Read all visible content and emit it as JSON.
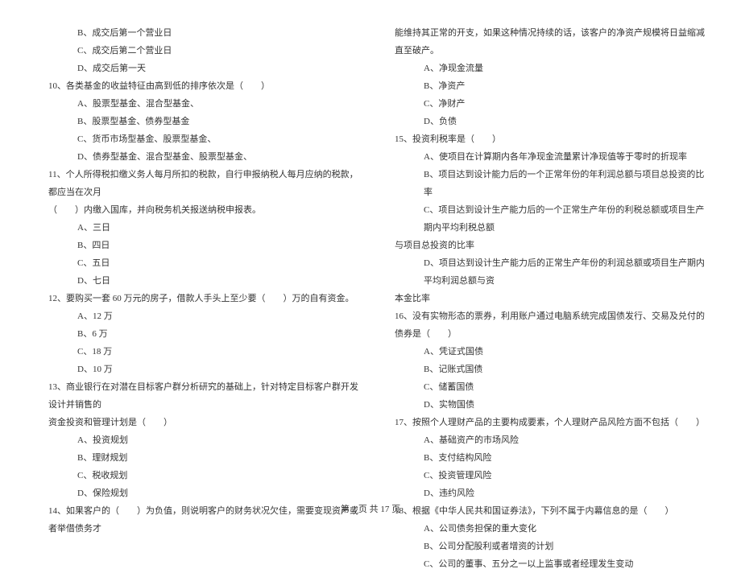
{
  "left": {
    "opt_b": "B、成交后第一个营业日",
    "opt_c": "C、成交后第二个营业日",
    "opt_d": "D、成交后第一天",
    "q10": "10、各类基金的收益特征由高到低的排序依次是（　　）",
    "q10_a": "A、股票型基金、混合型基金、",
    "q10_b": "B、股票型基金、债券型基金",
    "q10_c": "C、货币市场型基金、股票型基金、",
    "q10_d": "D、债券型基金、混合型基金、股票型基金、",
    "q11": "11、个人所得税扣缴义务人每月所扣的税款，自行申报纳税人每月应纳的税款，都应当在次月",
    "q11_cont": "（　　）内缴入国库，并向税务机关报送纳税申报表。",
    "q11_a": "A、三日",
    "q11_b": "B、四日",
    "q11_c": "C、五日",
    "q11_d": "D、七日",
    "q12": "12、要购买一套 60 万元的房子，借款人手头上至少要（　　）万的自有资金。",
    "q12_a": "A、12 万",
    "q12_b": "B、6 万",
    "q12_c": "C、18 万",
    "q12_d": "D、10 万",
    "q13": "13、商业银行在对潜在目标客户群分析研究的基础上，针对特定目标客户群开发设计并销售的",
    "q13_cont": "资金投资和管理计划是（　　）",
    "q13_a": "A、投资规划",
    "q13_b": "B、理财规划",
    "q13_c": "C、税收规划",
    "q13_d": "D、保险规划",
    "q14": "14、如果客户的（　　）为负值，则说明客户的财务状况欠佳，需要变现资产或者举借债务才"
  },
  "right": {
    "q14_cont": "能维持其正常的开支，如果这种情况持续的话，该客户的净资产规模将日益缩减直至破产。",
    "q14_a": "A、净现金流量",
    "q14_b": "B、净资产",
    "q14_c": "C、净财产",
    "q14_d": "D、负债",
    "q15": "15、投资利税率是（　　）",
    "q15_a": "A、使项目在计算期内各年净现金流量累计净现值等于零时的折现率",
    "q15_b": "B、项目达到设计能力后的一个正常年份的年利润总额与项目总投资的比率",
    "q15_c": "C、项目达到设计生产能力后的一个正常生产年份的利税总额或项目生产期内平均利税总额",
    "q15_c_cont": "与项目总投资的比率",
    "q15_d": "D、项目达到设计生产能力后的正常生产年份的利润总额或项目生产期内平均利润总额与资",
    "q15_d_cont": "本金比率",
    "q16": "16、没有实物形态的票券，利用账户通过电脑系统完成国债发行、交易及兑付的债券是（　　）",
    "q16_a": "A、凭证式国债",
    "q16_b": "B、记账式国债",
    "q16_c": "C、储蓄国债",
    "q16_d": "D、实物国债",
    "q17": "17、按照个人理财产品的主要构成要素，个人理财产品风险方面不包括（　　）",
    "q17_a": "A、基础资产的市场风险",
    "q17_b": "B、支付结构风险",
    "q17_c": "C、投资管理风险",
    "q17_d": "D、违约风险",
    "q18": "18、根据《中华人民共和国证券法》，下列不属于内幕信息的是（　　）",
    "q18_a": "A、公司债务担保的重大变化",
    "q18_b": "B、公司分配股利或者增资的计划",
    "q18_c": "C、公司的董事、五分之一以上监事或者经理发生变动"
  },
  "footer": "第 2 页 共 17 页"
}
